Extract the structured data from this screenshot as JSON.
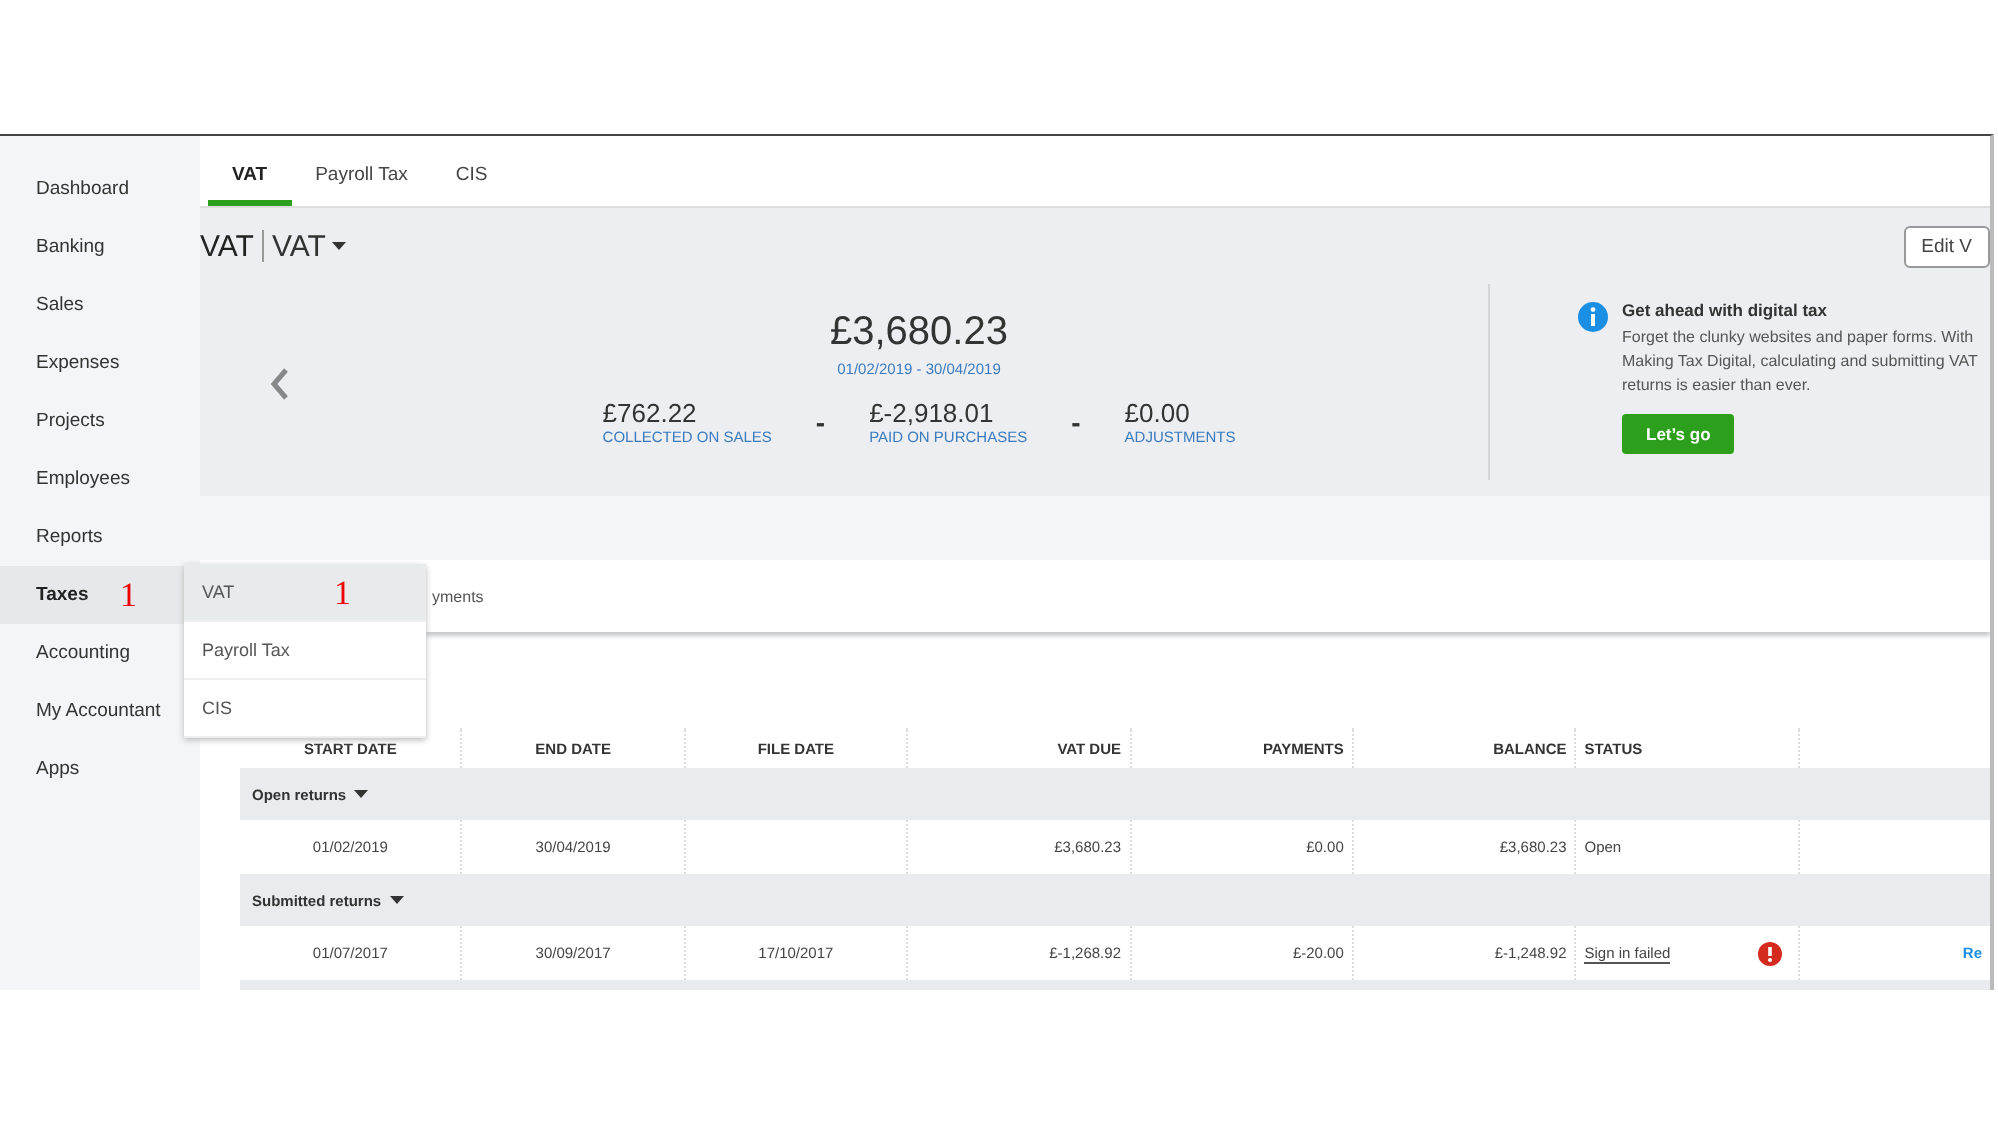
{
  "sidebar": {
    "items": [
      {
        "label": "Dashboard",
        "selected": false
      },
      {
        "label": "Banking",
        "selected": false
      },
      {
        "label": "Sales",
        "selected": false
      },
      {
        "label": "Expenses",
        "selected": false
      },
      {
        "label": "Projects",
        "selected": false
      },
      {
        "label": "Employees",
        "selected": false
      },
      {
        "label": "Reports",
        "selected": false
      },
      {
        "label": "Taxes",
        "selected": true,
        "annotation": "1"
      },
      {
        "label": "Accounting",
        "selected": false
      },
      {
        "label": "My Accountant",
        "selected": false
      },
      {
        "label": "Apps",
        "selected": false
      }
    ]
  },
  "tabs": [
    {
      "label": "VAT",
      "selected": true
    },
    {
      "label": "Payroll Tax",
      "selected": false
    },
    {
      "label": "CIS",
      "selected": false
    }
  ],
  "header": {
    "title": "VAT",
    "agency": "VAT",
    "edit_button": "Edit V"
  },
  "summary": {
    "total": "£3,680.23",
    "period": "01/02/2019 - 30/04/2019",
    "stats": [
      {
        "amount": "£762.22",
        "label": "COLLECTED ON SALES"
      },
      {
        "amount": "£-2,918.01",
        "label": "PAID ON PURCHASES"
      },
      {
        "amount": "£0.00",
        "label": "ADJUSTMENTS"
      }
    ],
    "separators": [
      "-",
      "-"
    ]
  },
  "promo": {
    "title": "Get ahead with digital tax",
    "body": "Forget the clunky websites and paper forms. With Making Tax Digital, calculating and submitting VAT returns is easier than ever.",
    "button": "Let’s go"
  },
  "card": {
    "tab_fragment": "yments"
  },
  "dropdown": {
    "items": [
      {
        "label": "VAT",
        "selected": true,
        "annotation": "1"
      },
      {
        "label": "Payroll Tax",
        "selected": false
      },
      {
        "label": "CIS",
        "selected": false
      }
    ]
  },
  "table": {
    "columns": [
      "START DATE",
      "END DATE",
      "FILE DATE",
      "VAT DUE",
      "PAYMENTS",
      "BALANCE",
      "STATUS"
    ],
    "rows": [
      {
        "kind": "group",
        "label": "Open returns"
      },
      {
        "kind": "data",
        "cells": [
          "01/02/2019",
          "30/04/2019",
          "",
          "£3,680.23",
          "£0.00",
          "£3,680.23"
        ],
        "status": "Open",
        "error": false
      },
      {
        "kind": "group",
        "label": "Submitted returns"
      },
      {
        "kind": "data",
        "cells": [
          "01/07/2017",
          "30/09/2017",
          "17/10/2017",
          "£-1,268.92",
          "£-20.00",
          "£-1,248.92"
        ],
        "status": "Sign in failed",
        "error": true,
        "action": "Re"
      }
    ]
  }
}
